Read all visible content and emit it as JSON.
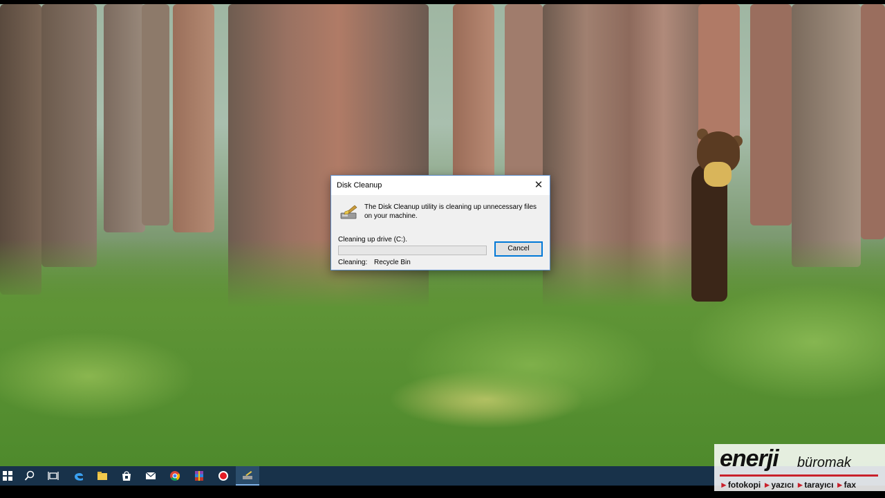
{
  "dialog": {
    "title": "Disk Cleanup",
    "close_glyph": "✕",
    "message": "The Disk Cleanup utility is cleaning up unnecessary files on your machine.",
    "drive_label": "Cleaning up drive  (C:).",
    "progress": 0,
    "cancel_label": "Cancel",
    "cleaning_label": "Cleaning:",
    "cleaning_value": "Recycle Bin",
    "icon": "disk-cleanup-icon"
  },
  "taskbar": {
    "items": [
      {
        "icon": "start-icon"
      },
      {
        "icon": "search-icon"
      },
      {
        "icon": "task-view-icon"
      },
      {
        "icon": "edge-icon"
      },
      {
        "icon": "file-explorer-icon"
      },
      {
        "icon": "store-icon"
      },
      {
        "icon": "mail-icon"
      },
      {
        "icon": "chrome-icon"
      },
      {
        "icon": "winrar-icon"
      },
      {
        "icon": "record-icon"
      },
      {
        "icon": "disk-cleanup-icon"
      }
    ],
    "colors": {
      "background": "#18324a",
      "active": "#2b4d6b"
    }
  },
  "watermark": {
    "brand_main": "enerji",
    "brand_sub": "büromak",
    "tags": [
      "fotokopi",
      "yazıcı",
      "tarayıcı",
      "fax"
    ]
  },
  "colors": {
    "accent": "#0078d7",
    "progress": "#06b025",
    "brand_red": "#c9202b"
  }
}
